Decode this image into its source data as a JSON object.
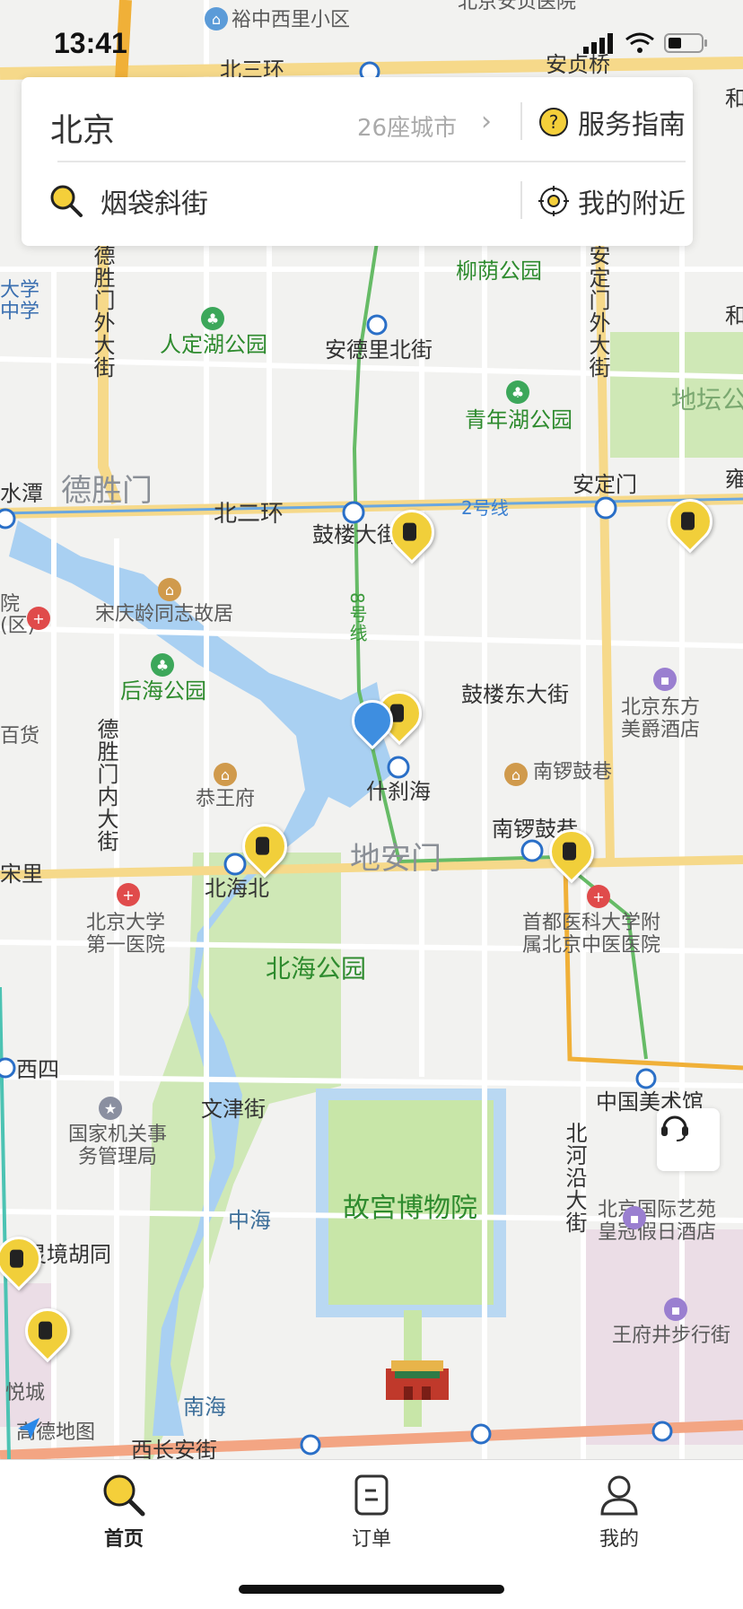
{
  "status_bar": {
    "time": "13:41"
  },
  "header": {
    "city": "北京",
    "city_count": "26座城市",
    "service_guide": "服务指南",
    "search_text": "烟袋斜街",
    "nearby": "我的附近"
  },
  "map": {
    "attribution": "高德地图",
    "labels": {
      "yuzhong": "裕中西里小区",
      "anzhen_hosp": "北京安贞医院",
      "anzhen_bridge": "安贞桥",
      "north3rd": "北三环",
      "liuyin": "柳荫公园",
      "renminhu": "人定湖公园",
      "andeli": "安德里北街",
      "qingnianhu": "青年湖公园",
      "ditan": "地坛公",
      "deshengmen": "德胜门",
      "north2nd": "北二环",
      "line2": "2号线",
      "andingmen": "安定门",
      "gulou": "鼓楼大街",
      "songqingling": "宋庆龄同志故居",
      "line8": "8号线",
      "houhai": "后海公园",
      "guloudong": "鼓楼东大街",
      "dongfang": "北京东方美爵酒店",
      "baihuo": "百货",
      "gongwangfu": "恭王府",
      "shichahai": "什刹海",
      "nanluoguxiang": "南锣鼓巷",
      "nanluogu_station": "南锣鼓巷",
      "dianmen": "地安门",
      "beihaibei": "北海北",
      "pku1": "北京大学第一医院",
      "tcm": "首都医科大学附属北京中医医院",
      "beihai": "北海公园",
      "xisi": "西四",
      "wenjin": "文津街",
      "guojiguan": "国家机关事务管理局",
      "meishuguan": "中国美术馆",
      "gugong": "故宫博物院",
      "zhonghai": "中海",
      "beiheyan": "北河沿大街",
      "crowne": "北京国际艺苑皇冠假日酒店",
      "lingjing": "灵境胡同",
      "wangfujing": "王府井步行街",
      "nanhai": "南海",
      "yuecheng": "悦城",
      "changan": "西长安街",
      "deshengmennei": "德胜门内大街",
      "andingmenwai": "安定门外大街",
      "deshengmenwai": "德胜门外大街",
      "daxue": "大学中学",
      "yuan": "院(区)",
      "shuitan": "水潭",
      "he1": "和",
      "he2": "和",
      "yong": "雍",
      "xizhimen": "宋里"
    }
  },
  "tabs": {
    "home": "首页",
    "orders": "订单",
    "mine": "我的"
  }
}
